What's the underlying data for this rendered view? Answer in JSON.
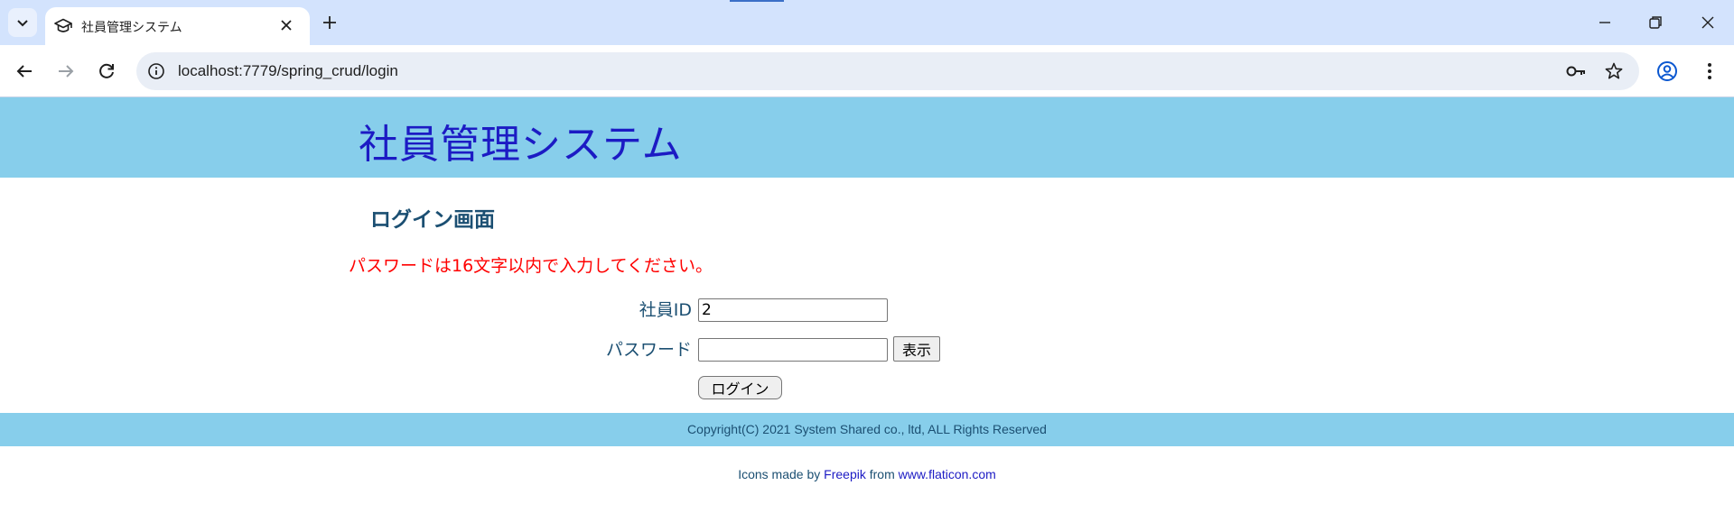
{
  "browser": {
    "tab_title": "社員管理システム",
    "url": "localhost:7779/spring_crud/login"
  },
  "header": {
    "title": "社員管理システム"
  },
  "login": {
    "heading": "ログイン画面",
    "error": "パスワードは16文字以内で入力してください。",
    "employee_id_label": "社員ID",
    "employee_id_value": "2",
    "password_label": "パスワード",
    "password_value": "",
    "show_button": "表示",
    "login_button": "ログイン"
  },
  "footer": {
    "copyright": "Copyright(C) 2021 System Shared co., ltd, ALL Rights Reserved"
  },
  "credits": {
    "prefix": "Icons made by",
    "author": "Freepik",
    "middle": "from",
    "site": "www.flaticon.com"
  },
  "colors": {
    "header_bg": "#87ceeb",
    "title": "#1c1bc4",
    "heading": "#1b4f72",
    "error": "#ff0000"
  },
  "icons": [
    "tab-search-icon",
    "graduation-cap-icon",
    "close-icon",
    "plus-icon",
    "minimize-icon",
    "restore-icon",
    "close-window-icon",
    "back-icon",
    "forward-icon",
    "reload-icon",
    "site-info-icon",
    "key-icon",
    "star-icon",
    "profile-icon",
    "menu-icon"
  ]
}
